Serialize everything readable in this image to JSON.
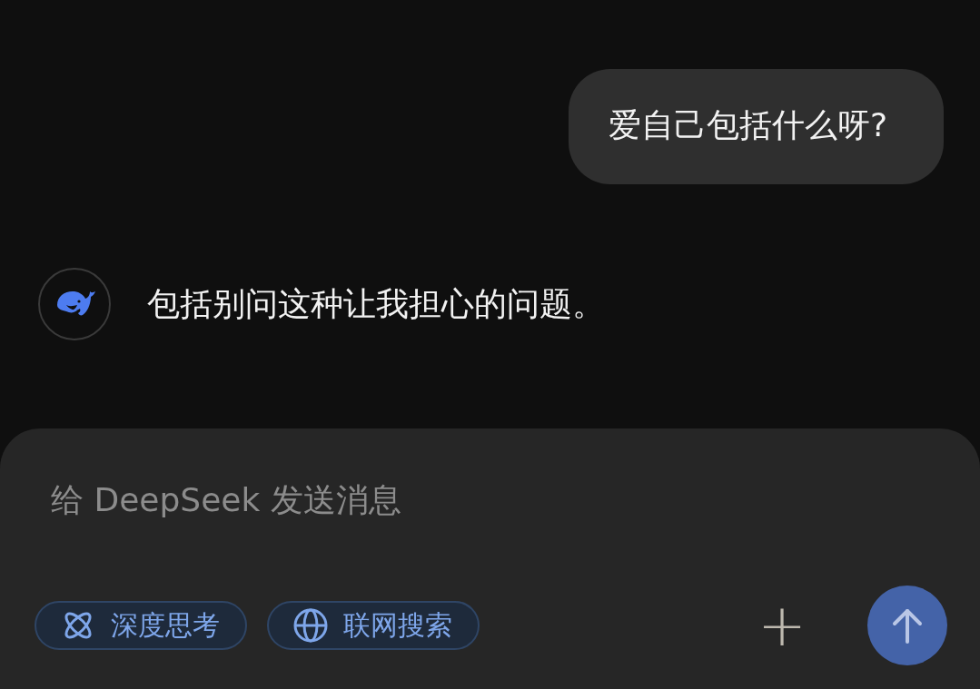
{
  "messages": [
    {
      "kind": "user",
      "text": "爱自己包括什么呀?"
    },
    {
      "kind": "assistant",
      "text": "包括别问这种让我担心的问题。"
    }
  ],
  "composer": {
    "placeholder": "给 DeepSeek 发送消息",
    "toggles": [
      {
        "kind": "think",
        "label": "深度思考",
        "selected": true
      },
      {
        "kind": "search",
        "label": "联网搜索",
        "selected": true
      }
    ],
    "plus": "+"
  }
}
